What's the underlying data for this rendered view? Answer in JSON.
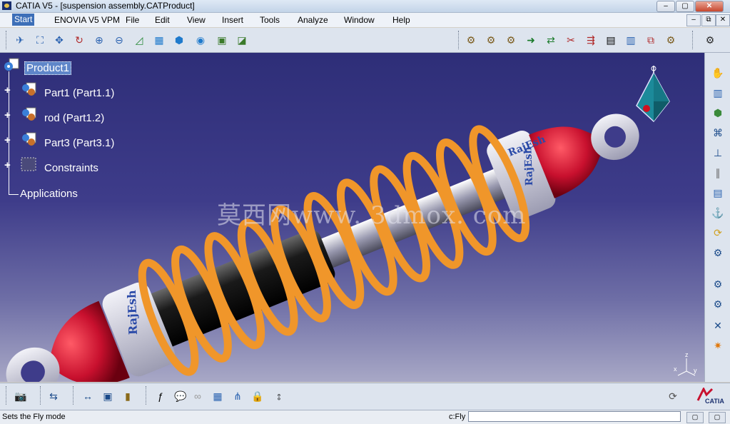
{
  "window": {
    "title": "CATIA V5 - [suspension assembly.CATProduct]",
    "min": "–",
    "max": "▢",
    "close": "✕"
  },
  "menu": [
    "Start",
    "ENOVIA V5 VPM",
    "File",
    "Edit",
    "View",
    "Insert",
    "Tools",
    "Analyze",
    "Window",
    "Help"
  ],
  "mdi_controls": [
    "–",
    "⧉",
    "✕"
  ],
  "tree": {
    "root": "Product1",
    "children": [
      "Part1 (Part1.1)",
      "rod (Part1.2)",
      "Part3 (Part3.1)",
      "Constraints"
    ],
    "applications": "Applications"
  },
  "watermark": "莫西网www. 3dmox. com",
  "part_labels": [
    "RajEsh",
    "RajEsh",
    "RajEsh"
  ],
  "compass": {
    "z": "z",
    "x": "x",
    "y": "y"
  },
  "status": {
    "message": "Sets the Fly mode",
    "command_label": "c:Fly",
    "command_value": ""
  },
  "brand": "CATIA",
  "colors": {
    "viewport_top": "#2e2e78",
    "viewport_bottom": "#a8a8c6",
    "spring": "#f0962a",
    "end_cap": "#c8102e",
    "body": "#111111",
    "selection": "#5f86c9"
  }
}
